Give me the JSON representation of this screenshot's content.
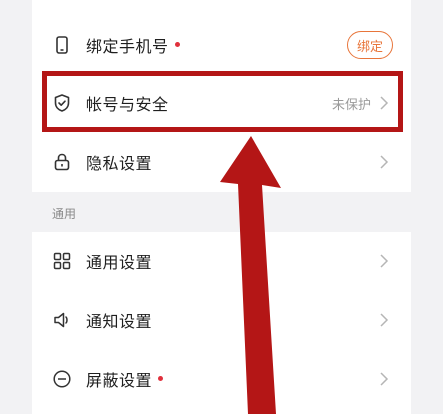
{
  "account": {
    "rows": [
      {
        "label": "绑定手机号",
        "has_dot": true,
        "button": "绑定",
        "icon": "phone-icon"
      },
      {
        "label": "帐号与安全",
        "value": "未保护",
        "icon": "shield-check-icon"
      },
      {
        "label": "隐私设置",
        "icon": "lock-icon"
      }
    ]
  },
  "general": {
    "section_title": "通用",
    "rows": [
      {
        "label": "通用设置",
        "icon": "grid-icon"
      },
      {
        "label": "通知设置",
        "icon": "speaker-icon"
      },
      {
        "label": "屏蔽设置",
        "has_dot": true,
        "icon": "minus-circle-icon"
      }
    ]
  },
  "colors": {
    "accent": "#e8753a",
    "badge": "#e0303c",
    "annotation": "#b41616"
  }
}
